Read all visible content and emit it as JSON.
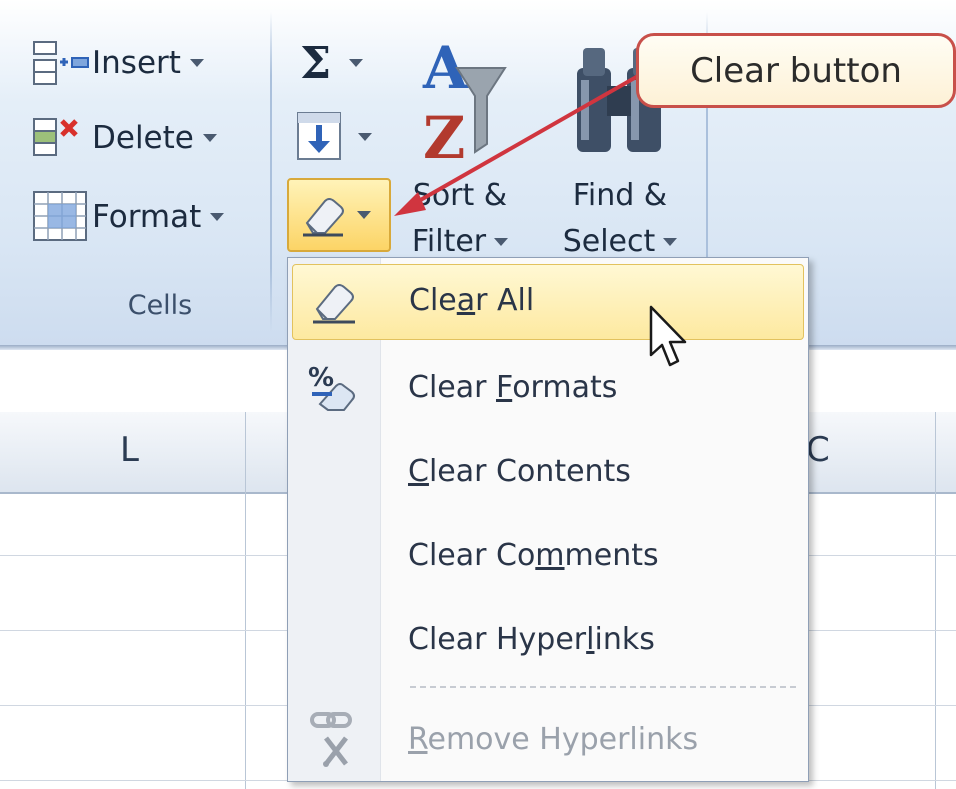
{
  "cells_group": {
    "insert_label": "Insert",
    "delete_label": "Delete",
    "format_label": "Format",
    "group_label": "Cells"
  },
  "editing_group": {
    "autosum_symbol": "Σ",
    "sort_filter_line1": "Sort &",
    "sort_filter_line2": "Filter",
    "find_select_line1": "Find &",
    "find_select_line2": "Select"
  },
  "callout": {
    "text": "Clear button"
  },
  "clear_menu": {
    "items": [
      {
        "pre": "Cle",
        "key": "a",
        "post": "r All",
        "icon": "eraser-icon",
        "state": "hover"
      },
      {
        "pre": "Clear ",
        "key": "F",
        "post": "ormats",
        "icon": "percent-eraser-icon",
        "state": "normal"
      },
      {
        "pre": "",
        "key": "C",
        "post": "lear Contents",
        "icon": "",
        "state": "normal"
      },
      {
        "pre": "Clear Co",
        "key": "m",
        "post": "ments",
        "icon": "",
        "state": "normal"
      },
      {
        "pre": "Clear Hyper",
        "key": "l",
        "post": "inks",
        "icon": "",
        "state": "normal"
      },
      {
        "pre": "",
        "key": "R",
        "post": "emove Hyperlinks",
        "icon": "remove-link-icon",
        "state": "disabled"
      }
    ]
  },
  "sheet": {
    "column_L": "L",
    "column_partial": "C"
  },
  "colors": {
    "accent_highlight": "#fde9a0",
    "callout_border": "#c8504a",
    "arrow": "#d0353f"
  }
}
